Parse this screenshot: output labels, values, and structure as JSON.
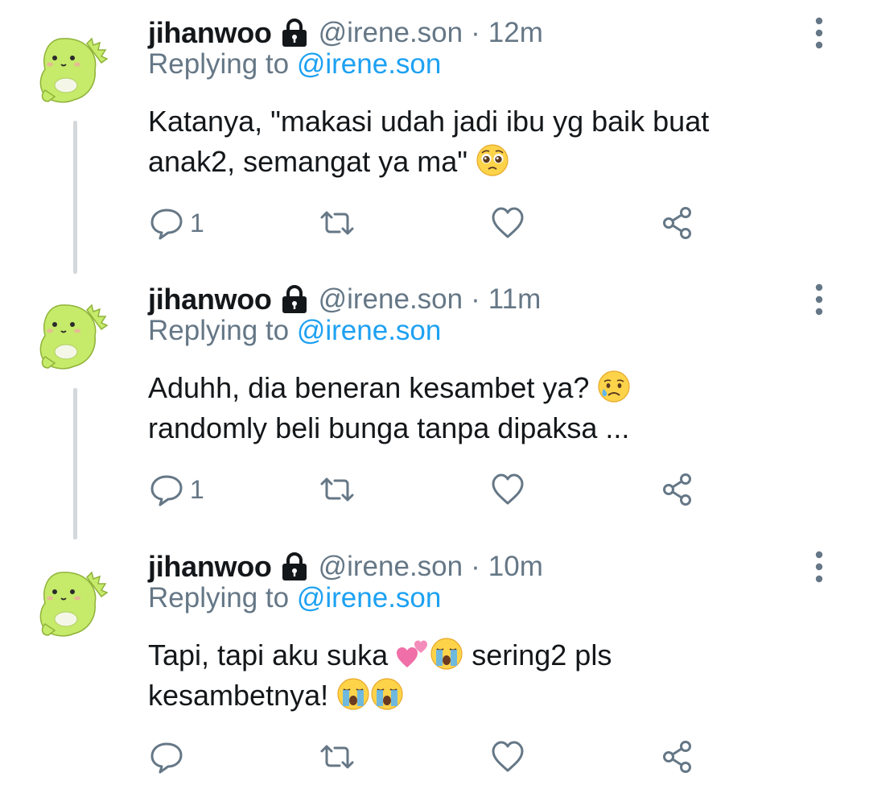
{
  "tweets": [
    {
      "display_name": "jihanwoo",
      "handle": "@irene.son",
      "separator": "·",
      "time": "12m",
      "replying_prefix": "Replying to",
      "replying_to": "@irene.son",
      "text_line1": "Katanya, \"makasi udah jadi ibu yg baik buat",
      "text_line2": "anak2, semangat ya ma\"",
      "emoji": [
        "pleading-face"
      ],
      "reply_count": "1"
    },
    {
      "display_name": "jihanwoo",
      "handle": "@irene.son",
      "separator": "·",
      "time": "11m",
      "replying_prefix": "Replying to",
      "replying_to": "@irene.son",
      "text_line1": "Aduhh, dia beneran kesambet ya?",
      "text_line2": "randomly beli bunga tanpa dipaksa ...",
      "emoji": [
        "sad-but-relieved-face"
      ],
      "reply_count": "1"
    },
    {
      "display_name": "jihanwoo",
      "handle": "@irene.son",
      "separator": "·",
      "time": "10m",
      "replying_prefix": "Replying to",
      "replying_to": "@irene.son",
      "text_line1_a": "Tapi, tapi aku suka",
      "text_line1_b": "sering2 pls",
      "text_line2": "kesambetnya!",
      "emoji": [
        "two-hearts",
        "loudly-crying-face",
        "loudly-crying-face",
        "loudly-crying-face"
      ],
      "reply_count": ""
    }
  ],
  "icons": {
    "avatar": "green-dinosaur-avatar",
    "lock": "protected-lock-icon",
    "more": "more-vertical-icon",
    "reply": "reply-icon",
    "retweet": "retweet-icon",
    "like": "like-icon",
    "share": "share-icon"
  },
  "colors": {
    "text": "#14171a",
    "secondary": "#657786",
    "link": "#1da1f2",
    "thread_line": "#d4d8db",
    "avatar_green": "#c6ea6a"
  }
}
